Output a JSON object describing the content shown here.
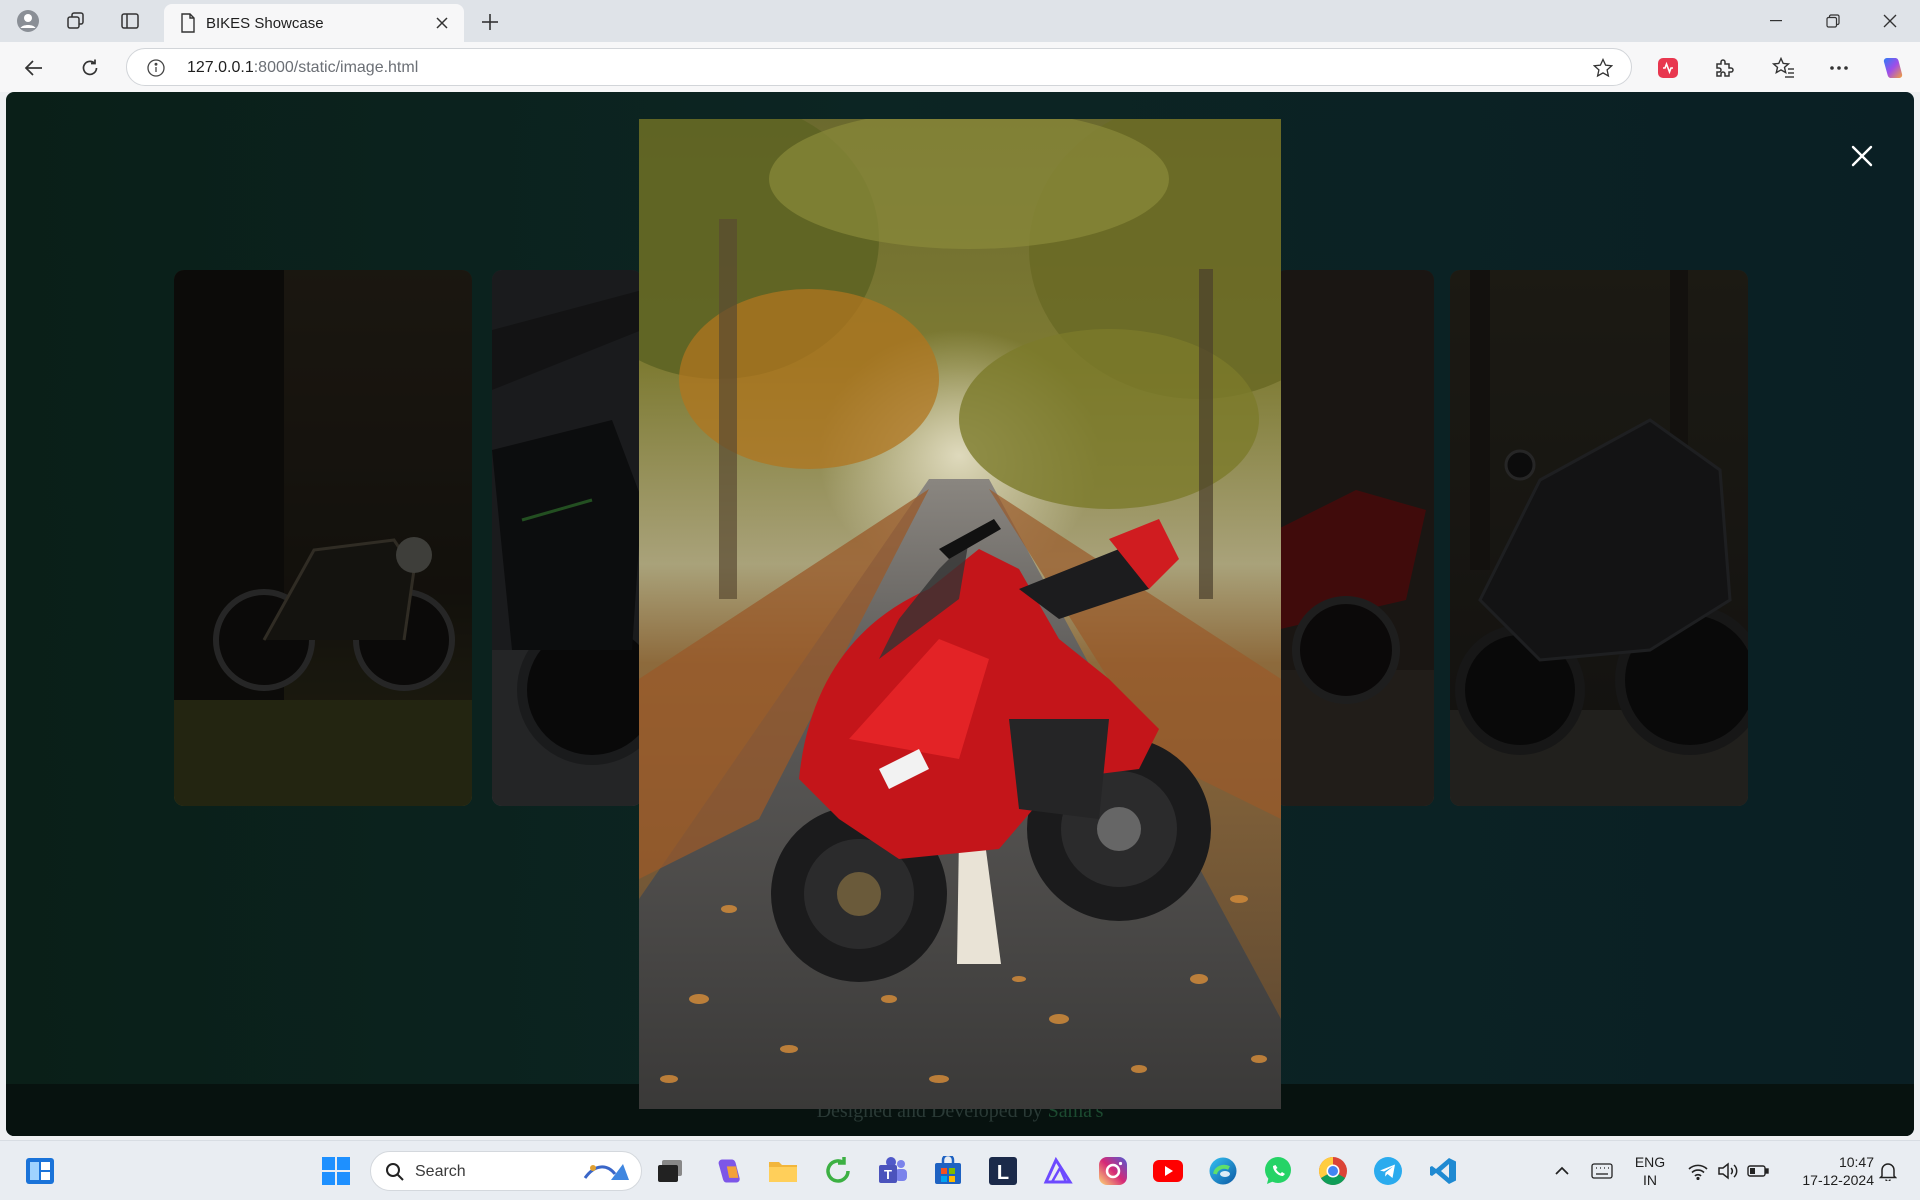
{
  "browser": {
    "tab_title": "BIKES Showcase",
    "url_host": "127.0.0.1",
    "url_rest": ":8000/static/image.html"
  },
  "page": {
    "footer_prefix": "Designed and Developed by ",
    "footer_author": "Sama's",
    "gallery": [
      {
        "icon": "bike-photo-classic"
      },
      {
        "icon": "bike-photo-green-naked"
      },
      {
        "icon": "bike-photo-red-sport"
      },
      {
        "icon": "bike-photo-black-sport"
      }
    ],
    "lightbox": {
      "photo": "red-ducati-autumn-road"
    }
  },
  "taskbar": {
    "search_label": "Search",
    "lang_top": "ENG",
    "lang_bottom": "IN",
    "time": "10:47",
    "date": "17-12-2024"
  },
  "colors": {
    "accent": "#0c2523",
    "footer_author": "#1c4a30"
  }
}
